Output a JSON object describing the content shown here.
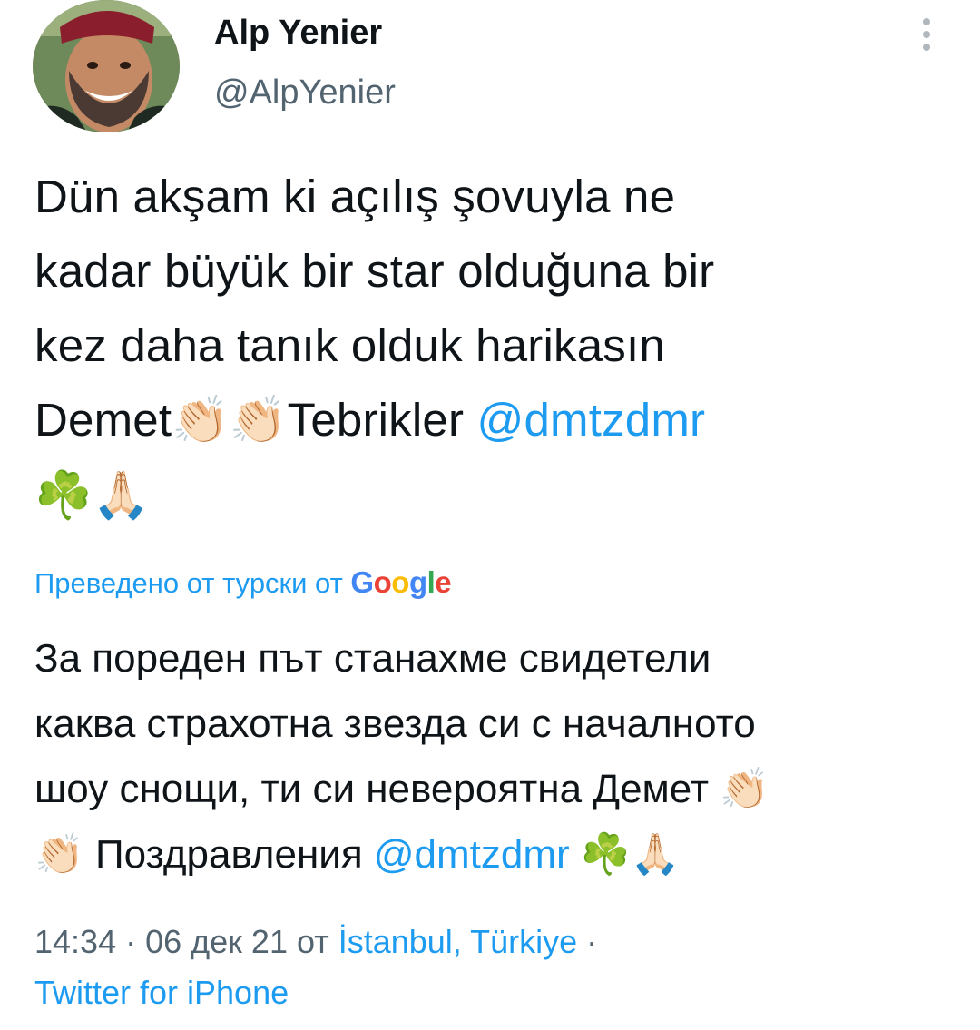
{
  "author": {
    "display_name": "Alp Yenier",
    "handle": "@AlpYenier",
    "avatar_icon": "user-avatar-photo"
  },
  "more_icon": "more-vertical-icon",
  "tweet": {
    "line1": "Dün akşam ki açılış şovuyla ne",
    "line2": "kadar büyük bir star olduğuna bir",
    "line3": "kez daha tanık olduk harikasın",
    "line4_start": "Demet",
    "clap_emoji": "👏🏻",
    "line4_mid": "Tebrikler ",
    "mention": "@dmtzdmr",
    "clover_emoji": "☘️",
    "pray_emoji": "🙏🏻"
  },
  "translation": {
    "label": "Преведено от турски от ",
    "google": {
      "G": "G",
      "o1": "o",
      "o2": "o",
      "g": "g",
      "l": "l",
      "e": "e"
    },
    "line1": "За пореден път станахме свидетели",
    "line2": "каква страхотна звезда си с началното",
    "line3_start": "шоу снощи, ти си невероятна Демет ",
    "line4_start": " Поздравления ",
    "mention": "@dmtzdmr"
  },
  "meta": {
    "time": "14:34",
    "sep1": " · ",
    "date": "06 дек 21",
    "from": " от ",
    "location": "İstanbul, Türkiye",
    "sep2": " ·",
    "source": "Twitter for iPhone"
  },
  "colors": {
    "link": "#1d9bf0",
    "text": "#0f1419",
    "secondary": "#536471"
  }
}
